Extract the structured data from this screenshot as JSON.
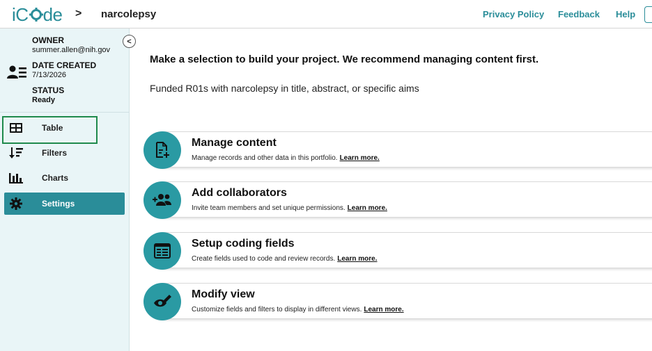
{
  "header": {
    "logo_text_pre": "i",
    "logo_text_post": "de",
    "breadcrumb_separator": ">",
    "project_title": "narcolepsy",
    "nav": [
      {
        "label": "Privacy Policy"
      },
      {
        "label": "Feedback"
      },
      {
        "label": "Help"
      }
    ]
  },
  "sidebar": {
    "collapse_glyph": "<",
    "owner_label": "OWNER",
    "owner_value": "summer.allen@nih.gov",
    "date_label": "DATE CREATED",
    "date_value": "7/13/2026",
    "status_label": "STATUS",
    "status_value": "Ready",
    "items": [
      {
        "label": "Table",
        "icon": "table-icon",
        "active": false
      },
      {
        "label": "Filters",
        "icon": "sort-filter-icon",
        "active": false
      },
      {
        "label": "Charts",
        "icon": "bar-chart-icon",
        "active": false
      },
      {
        "label": "Settings",
        "icon": "gear-icon",
        "active": true
      }
    ]
  },
  "main": {
    "heading": "Make a selection to build your project. We recommend managing content first.",
    "subheading": "Funded R01s with narcolepsy in title, abstract, or specific aims",
    "cards": [
      {
        "title": "Manage content",
        "desc": "Manage records and other data in this portfolio.",
        "link": "Learn more.",
        "icon": "document-add-icon"
      },
      {
        "title": "Add collaborators",
        "desc": "Invite team members and set unique permissions.",
        "link": "Learn more.",
        "icon": "add-people-icon"
      },
      {
        "title": "Setup coding fields",
        "desc": "Create fields used to code and review records.",
        "link": "Learn more.",
        "icon": "coding-fields-icon"
      },
      {
        "title": "Modify view",
        "desc": "Customize fields and filters to display in different views.",
        "link": "Learn more.",
        "icon": "eye-edit-icon"
      }
    ]
  },
  "colors": {
    "brand": "#2a8d99",
    "card_icon": "#2a9aa3",
    "sidebar_bg": "#e9f5f7",
    "highlight": "#1f8a4c"
  }
}
